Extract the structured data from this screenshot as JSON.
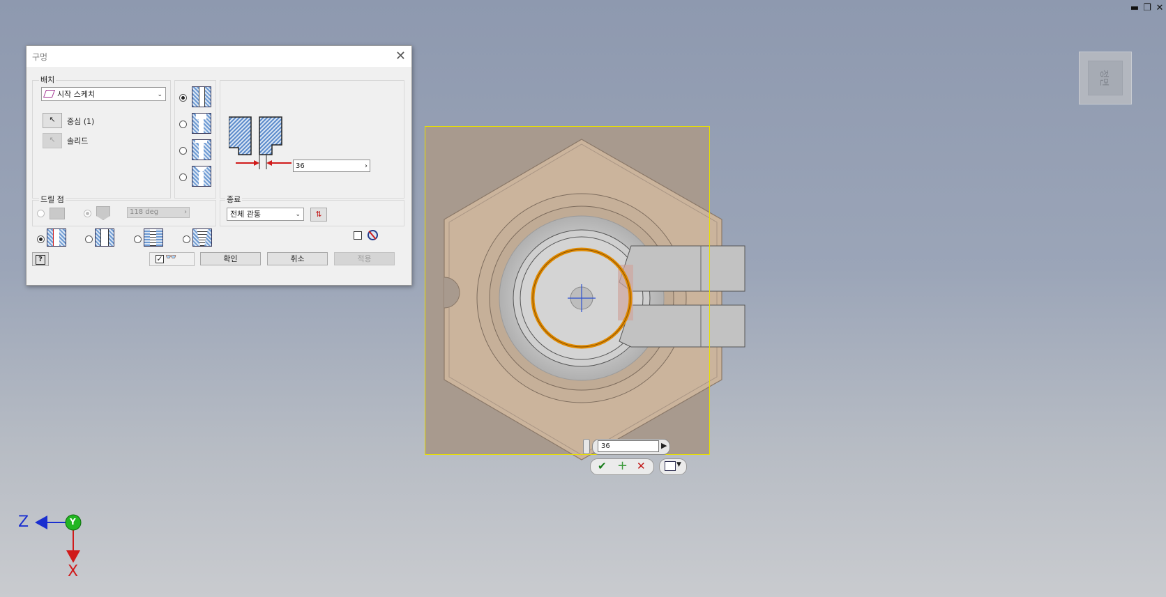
{
  "window": {
    "minimize": "▬",
    "restore": "❐",
    "close": "✕"
  },
  "viewcube": {
    "face_label": "정면"
  },
  "dialog": {
    "title": "구멍",
    "placement": {
      "group_label": "배치",
      "sketch_select": "시작 스케치",
      "center_label": "중심 (1)",
      "solid_label": "솔리드"
    },
    "drill_point": {
      "group_label": "드릴 점",
      "angle": "118 deg"
    },
    "termination": {
      "group_label": "종료",
      "select": "전체 관통"
    },
    "diameter_value": "36",
    "buttons": {
      "ok": "확인",
      "cancel": "취소",
      "apply": "적용",
      "help": "?"
    }
  },
  "viewport": {
    "mini_input_value": "36",
    "colors": {
      "part": "#cbb49c",
      "selection": "#e8e000",
      "ring": "#e08a00"
    }
  },
  "triad": {
    "z": "Z",
    "y": "Y",
    "x": "X"
  }
}
